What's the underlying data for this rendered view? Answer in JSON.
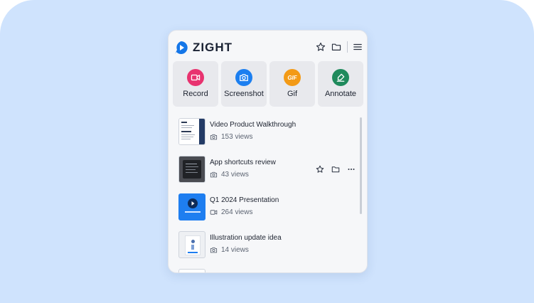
{
  "brand": {
    "name": "ZIGHT",
    "color": "#1476e8"
  },
  "header": {
    "icons": [
      "star-icon",
      "folder-icon",
      "menu-icon"
    ]
  },
  "actions": [
    {
      "label": "Record",
      "icon": "record-icon",
      "color": "#e8336f"
    },
    {
      "label": "Screenshot",
      "icon": "camera-icon",
      "color": "#1c7ff0"
    },
    {
      "label": "Gif",
      "icon": "gif-icon",
      "color": "#f39a16",
      "badge": "GIF"
    },
    {
      "label": "Annotate",
      "icon": "pen-icon",
      "color": "#1f8a5c"
    }
  ],
  "items": [
    {
      "title": "Video Product Walkthrough",
      "views": "153 views",
      "type": "screenshot"
    },
    {
      "title": "App shortcuts review",
      "views": "43 views",
      "type": "screenshot"
    },
    {
      "title": "Q1 2024 Presentation",
      "views": "264 views",
      "type": "video"
    },
    {
      "title": "Illustration update idea",
      "views": "14 views",
      "type": "screenshot"
    }
  ]
}
